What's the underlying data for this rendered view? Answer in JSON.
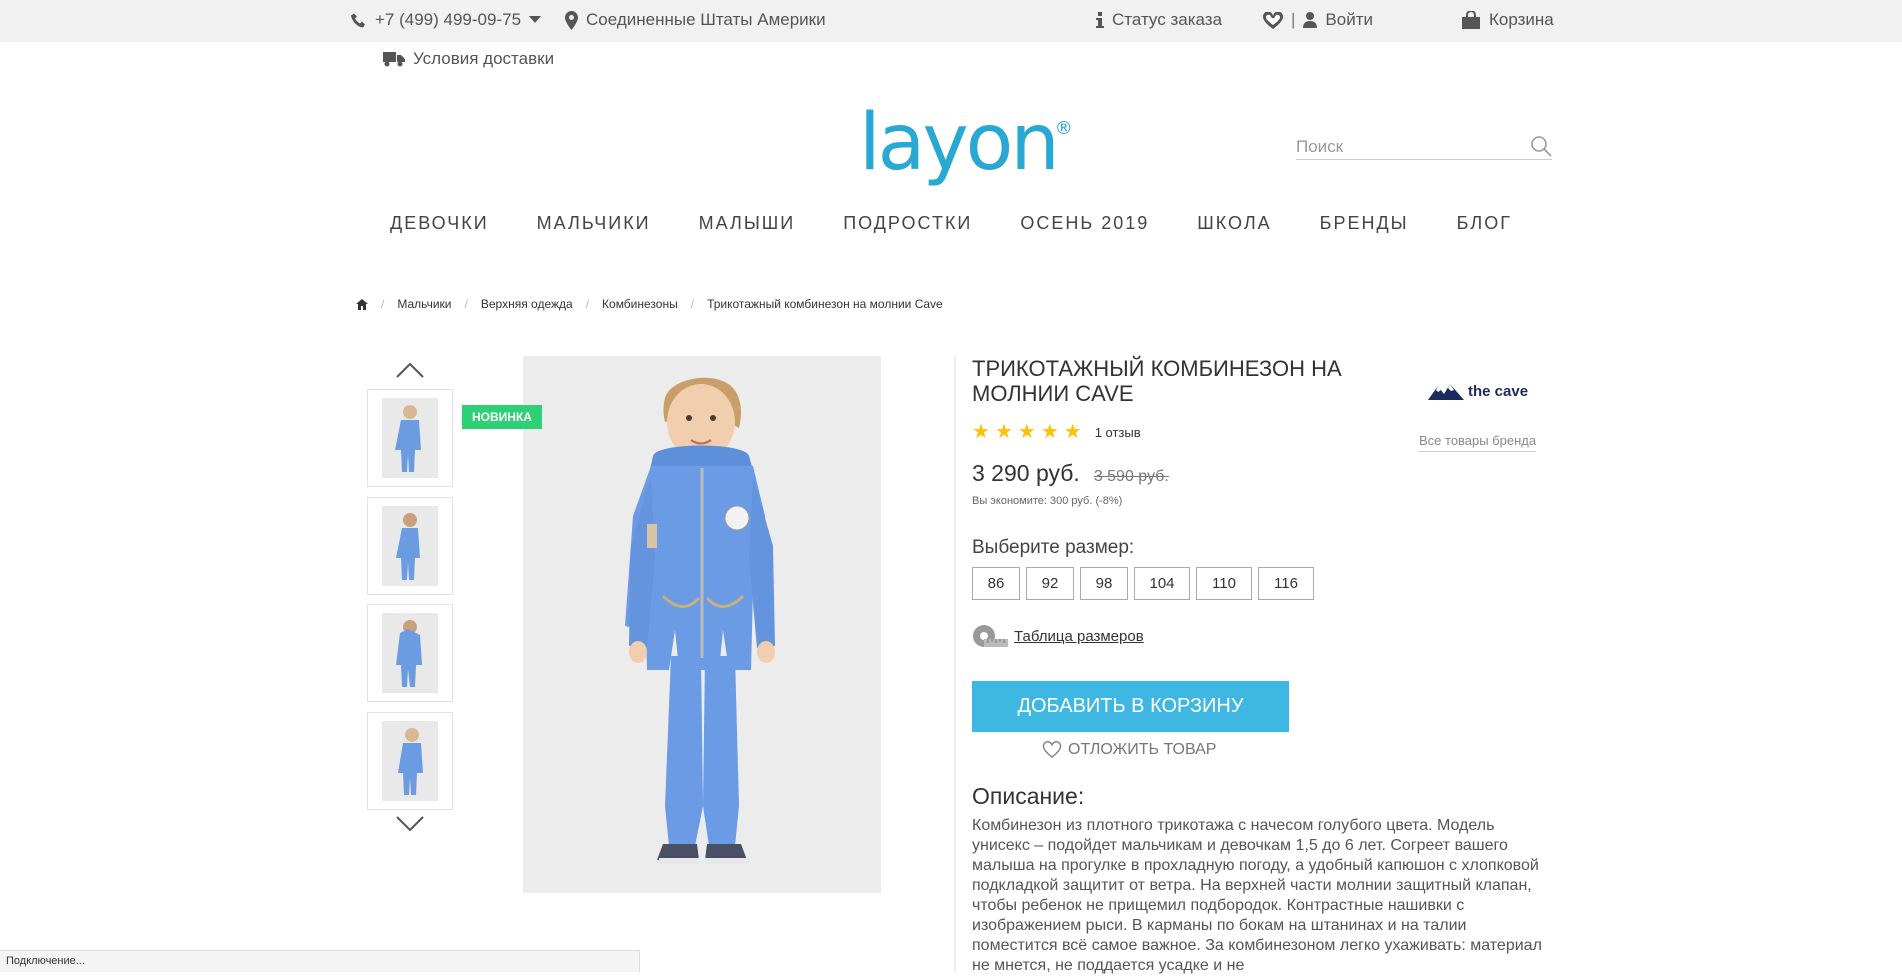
{
  "topbar": {
    "phone": "+7 (499) 499-09-75",
    "country": "Соединенные Штаты Америки",
    "order_status": "Статус заказа",
    "divider": "|",
    "login": "Войти",
    "cart": "Корзина"
  },
  "delivery": "Условия доставки",
  "logo": {
    "text": "layon",
    "mark": "®"
  },
  "search": {
    "placeholder": "Поиск"
  },
  "nav": [
    "ДЕВОЧКИ",
    "МАЛЬЧИКИ",
    "МАЛЫШИ",
    "ПОДРОСТКИ",
    "ОСЕНЬ 2019",
    "ШКОЛА",
    "БРЕНДЫ",
    "БЛОГ"
  ],
  "breadcrumbs": {
    "sep": "/",
    "items": [
      "Мальчики",
      "Верхняя одежда",
      "Комбинезоны",
      "Трикотажный комбинезон на молнии Cave"
    ]
  },
  "gallery": {
    "badge": "НОВИНКА"
  },
  "product": {
    "title": "ТРИКОТАЖНЫЙ КОМБИНЕЗОН НА МОЛНИИ CAVE",
    "rating": 5,
    "reviews": "1 отзыв",
    "price": "3 290 руб.",
    "old_price": "3 590 руб.",
    "savings": "Вы экономите: 300 руб. (-8%)",
    "size_label": "Выберите размер:",
    "sizes": [
      "86",
      "92",
      "98",
      "104",
      "110",
      "116"
    ],
    "size_table": "Таблица размеров",
    "add_to_cart": "ДОБАВИТЬ В КОРЗИНУ",
    "wishlist": "ОТЛОЖИТЬ ТОВАР"
  },
  "brand": {
    "name": "the cave",
    "all_products": "Все товары бренда"
  },
  "description": {
    "heading": "Описание:",
    "text": "Комбинезон из плотного трикотажа с начесом голубого цвета. Модель унисекс – подойдет мальчикам и девочкам 1,5 до 6 лет. Согреет вашего малыша на прогулке в прохладную погоду, а удобный капюшон с хлопковой подкладкой защитит от ветра. На верхней части молнии защитный клапан, чтобы ребенок не прищемил подбородок. Контрастные нашивки с изображением рыси. В карманы по бокам на штанинах и на талии поместится всё самое важное. За комбинезоном легко ухаживать: материал не мнется, не поддается усадке и не"
  },
  "statusbar": "Подключение...",
  "colors": {
    "accent": "#3eb8e3",
    "logo": "#29a8d3",
    "badge": "#2dd075",
    "star": "#ffc107"
  }
}
